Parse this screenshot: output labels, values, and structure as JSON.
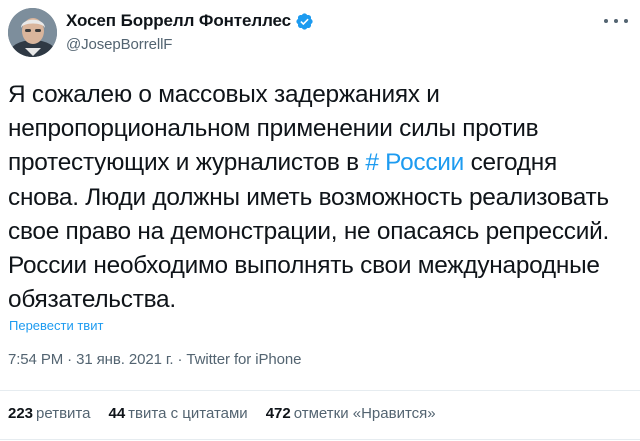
{
  "author": {
    "name": "Хосеп Боррелл Фонтеллес",
    "handle": "@JosepBorrellF",
    "verified": true,
    "avatar_icon": "profile-photo"
  },
  "tweet": {
    "text_before": "Я сожалею о массовых задержаниях и непропорциональном применении силы против протестующих и журналистов в ",
    "hashtag": "# России",
    "text_after": " сегодня снова. Люди должны иметь возможность реализовать свое право на демонстрации, не опасаясь репрессий. России необходимо выполнять свои международные обязательства."
  },
  "translate_label": "Перевести твит",
  "meta": {
    "time": "7:54 PM",
    "sep1": "·",
    "date": "31 янв. 2021 г.",
    "sep2": "·",
    "source": "Twitter for iPhone"
  },
  "stats": [
    {
      "count": "223",
      "label": "ретвита"
    },
    {
      "count": "44",
      "label": "твита с цитатами"
    },
    {
      "count": "472",
      "label": "отметки «Нравится»"
    }
  ],
  "colors": {
    "accent": "#1d9bf0",
    "text_primary": "#0f1419",
    "text_secondary": "#536471",
    "divider": "#e6ecf0"
  },
  "icons": {
    "verified": "verified-badge-icon",
    "more": "more-options-icon"
  }
}
